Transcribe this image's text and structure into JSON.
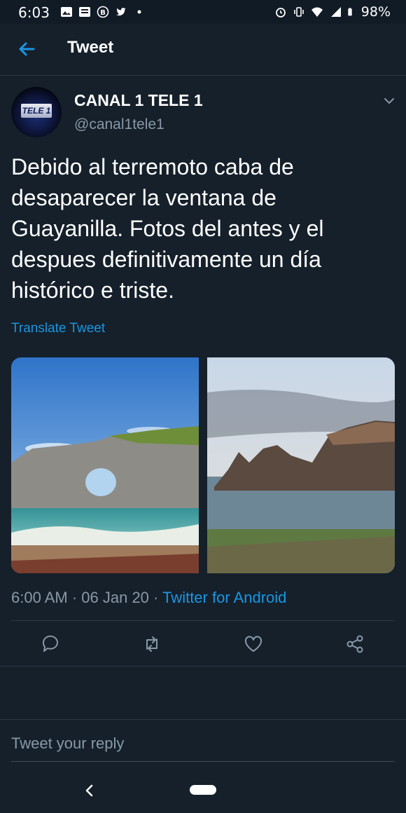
{
  "status_bar": {
    "time": "6:03",
    "battery": "98%"
  },
  "header": {
    "title": "Tweet"
  },
  "tweet": {
    "author_name": "CANAL 1 TELE 1",
    "author_handle": "@canal1tele1",
    "avatar_logo_text": "TELE 1",
    "text": "Debido al terremoto caba de desaparecer la ventana de Guayanilla. Fotos del antes y el despues definitivamente un día histórico e triste.",
    "translate_label": "Translate Tweet",
    "time": "6:00 AM",
    "date": "06 Jan 20",
    "source": "Twitter for Android"
  },
  "reply": {
    "placeholder": "Tweet your reply"
  },
  "colors": {
    "background": "#15202b",
    "accent": "#1b95e0",
    "secondary_text": "#8899a6",
    "divider": "#2b3945"
  },
  "icons": {
    "back": "arrow-left-icon",
    "more": "chevron-down-icon",
    "reply": "comment-icon",
    "retweet": "retweet-icon",
    "like": "heart-icon",
    "share": "share-icon"
  }
}
